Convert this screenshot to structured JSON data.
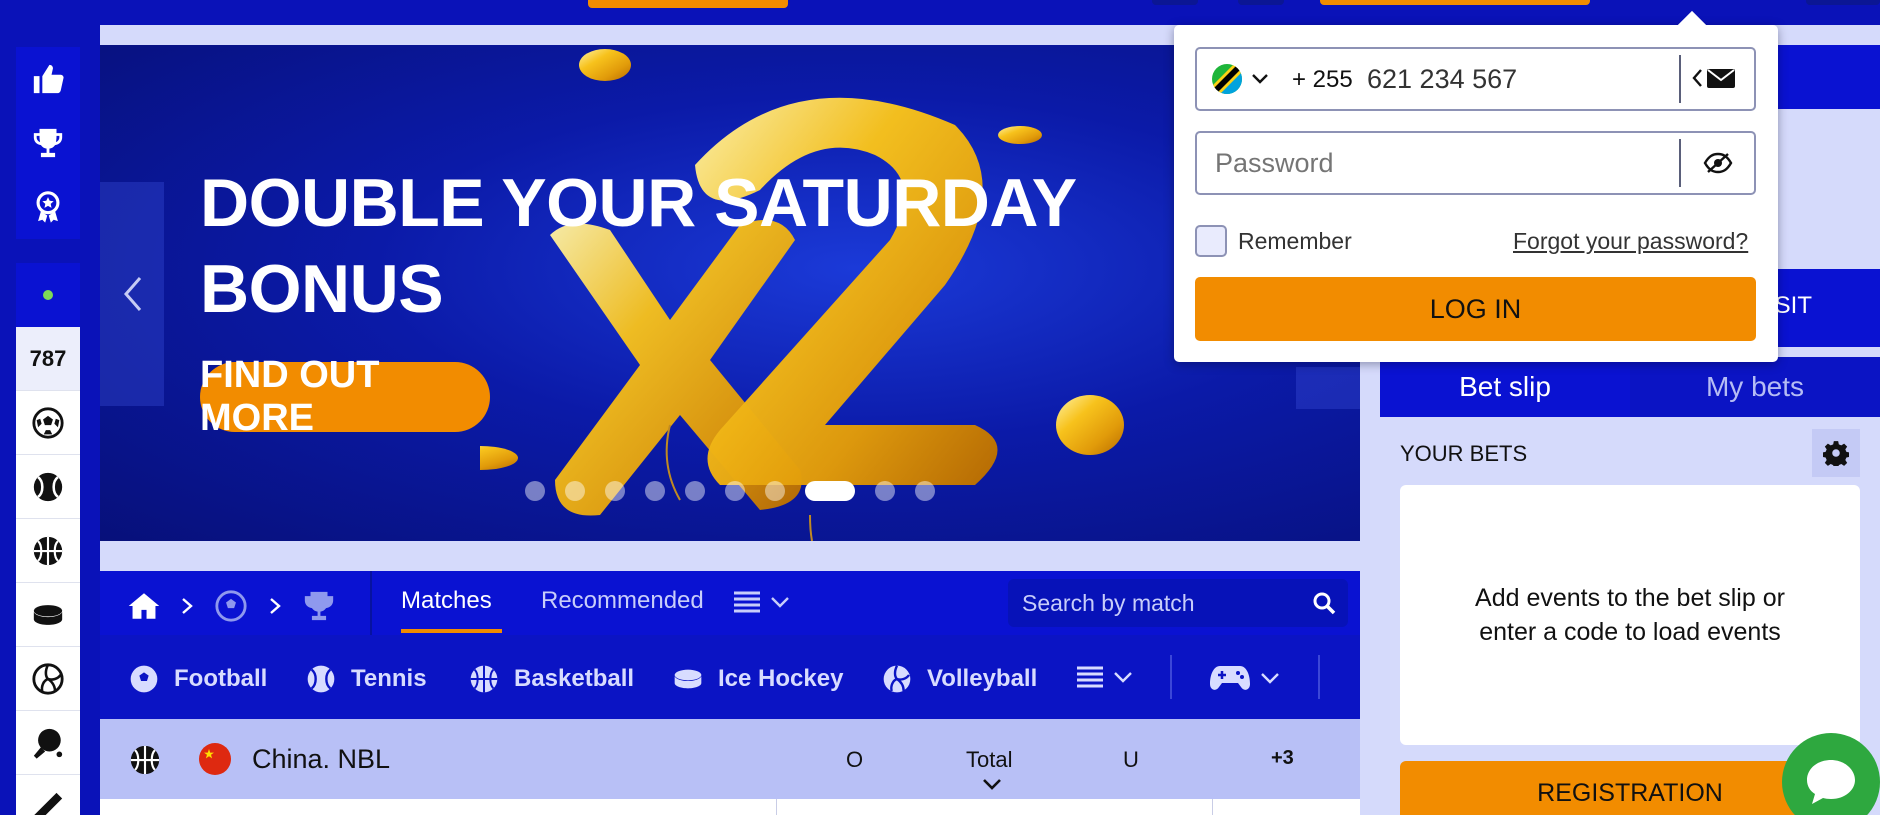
{
  "banner": {
    "title_line1": "DOUBLE YOUR SATURDAY",
    "title_line2": "BONUS",
    "cta_label": "FIND OUT MORE",
    "big_text": "x2",
    "slide_count": 10,
    "active_slide": 8
  },
  "breadcrumb": {
    "icons": [
      "home-icon",
      "soccer-ball-icon",
      "trophy-icon"
    ]
  },
  "tabs": {
    "matches": "Matches",
    "recommended": "Recommended"
  },
  "search": {
    "placeholder": "Search by match"
  },
  "sports": [
    {
      "label": "Football",
      "icon": "football-icon"
    },
    {
      "label": "Tennis",
      "icon": "tennis-icon"
    },
    {
      "label": "Basketball",
      "icon": "basketball-icon"
    },
    {
      "label": "Ice Hockey",
      "icon": "ice-hockey-icon"
    },
    {
      "label": "Volleyball",
      "icon": "volleyball-icon"
    }
  ],
  "event": {
    "league": "China. NBL",
    "col_o": "O",
    "col_total": "Total",
    "col_u": "U",
    "more": "+3"
  },
  "rail": {
    "live_count": "787"
  },
  "login": {
    "country_code": "+ 255",
    "phone_value": "621 234 567",
    "password_placeholder": "Password",
    "remember_label": "Remember",
    "forgot_label": "Forgot your password?",
    "login_button": "LOG IN"
  },
  "betslip": {
    "deposit_partial": "OSIT",
    "tab_betslip": "Bet slip",
    "tab_mybets": "My bets",
    "your_bets": "YOUR BETS",
    "empty_line1": "Add events to the bet slip or",
    "empty_line2": "enter a code to load events",
    "registration": "REGISTRATION"
  },
  "colors": {
    "primary_blue": "#0a12d2",
    "accent_orange": "#f28c00",
    "light_lilac": "#d5dafb",
    "chat_green": "#2ea83f"
  }
}
